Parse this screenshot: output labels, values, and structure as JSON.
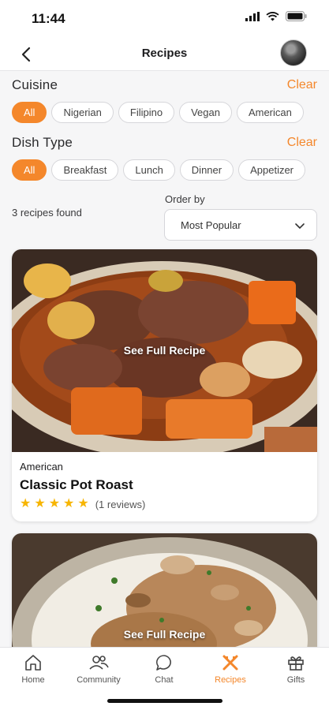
{
  "status_bar": {
    "time": "11:44"
  },
  "header": {
    "title": "Recipes"
  },
  "filters": {
    "cuisine": {
      "title": "Cuisine",
      "clear_label": "Clear",
      "chips": [
        "All",
        "Nigerian",
        "Filipino",
        "Vegan",
        "American"
      ],
      "selected": "All"
    },
    "dish_type": {
      "title": "Dish Type",
      "clear_label": "Clear",
      "chips": [
        "All",
        "Breakfast",
        "Lunch",
        "Dinner",
        "Appetizer"
      ],
      "selected": "All"
    }
  },
  "results": {
    "count_text": "3 recipes found"
  },
  "order": {
    "label": "Order by",
    "value": "Most Popular"
  },
  "recipes": [
    {
      "overlay_label": "See Full Recipe",
      "cuisine": "American",
      "title": "Classic Pot Roast",
      "rating": 5,
      "reviews": "(1 reviews)"
    },
    {
      "overlay_label": "See Full Recipe"
    }
  ],
  "tabs": [
    {
      "label": "Home",
      "icon": "home-icon"
    },
    {
      "label": "Community",
      "icon": "community-icon"
    },
    {
      "label": "Chat",
      "icon": "chat-icon"
    },
    {
      "label": "Recipes",
      "icon": "recipes-icon",
      "active": true
    },
    {
      "label": "Gifts",
      "icon": "gift-icon"
    }
  ],
  "colors": {
    "accent": "#f4872b",
    "star": "#f7b500"
  }
}
